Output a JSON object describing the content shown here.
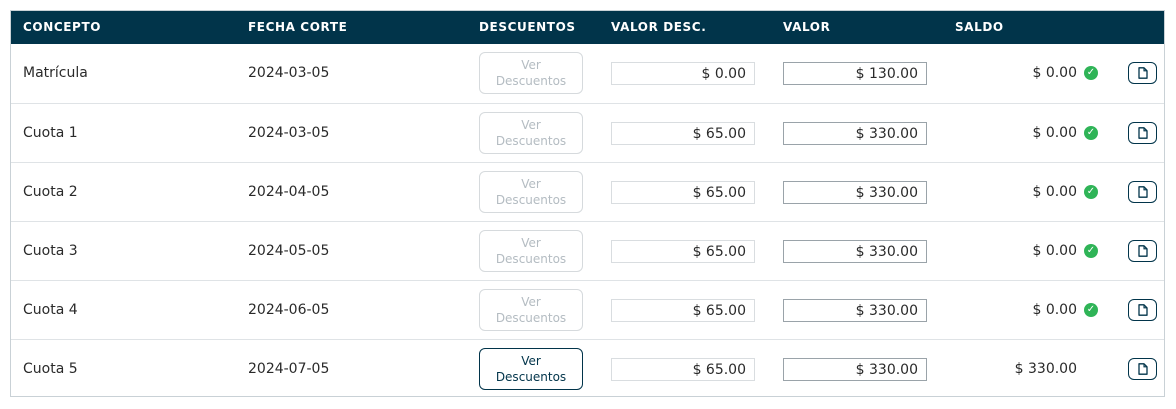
{
  "header": {
    "concepto": "CONCEPTO",
    "fecha_corte": "FECHA CORTE",
    "descuentos": "DESCUENTOS",
    "valor_desc": "VALOR DESC.",
    "valor": "VALOR",
    "saldo": "SALDO"
  },
  "button_label_line1": "Ver",
  "button_label_line2": "Descuentos",
  "rows": [
    {
      "concepto": "Matrícula",
      "fecha": "2024-03-05",
      "valor_desc": "$ 0.00",
      "valor": "$ 130.00",
      "saldo": "$ 0.00",
      "paid": true,
      "descuentos_enabled": false
    },
    {
      "concepto": "Cuota 1",
      "fecha": "2024-03-05",
      "valor_desc": "$ 65.00",
      "valor": "$ 330.00",
      "saldo": "$ 0.00",
      "paid": true,
      "descuentos_enabled": false
    },
    {
      "concepto": "Cuota 2",
      "fecha": "2024-04-05",
      "valor_desc": "$ 65.00",
      "valor": "$ 330.00",
      "saldo": "$ 0.00",
      "paid": true,
      "descuentos_enabled": false
    },
    {
      "concepto": "Cuota 3",
      "fecha": "2024-05-05",
      "valor_desc": "$ 65.00",
      "valor": "$ 330.00",
      "saldo": "$ 0.00",
      "paid": true,
      "descuentos_enabled": false
    },
    {
      "concepto": "Cuota 4",
      "fecha": "2024-06-05",
      "valor_desc": "$ 65.00",
      "valor": "$ 330.00",
      "saldo": "$ 0.00",
      "paid": true,
      "descuentos_enabled": false
    },
    {
      "concepto": "Cuota 5",
      "fecha": "2024-07-05",
      "valor_desc": "$ 65.00",
      "valor": "$ 330.00",
      "saldo": "$ 330.00",
      "paid": false,
      "descuentos_enabled": true
    }
  ],
  "colors": {
    "header_bg": "#01344a",
    "paid_check": "#2fb457",
    "accent": "#01344a"
  }
}
